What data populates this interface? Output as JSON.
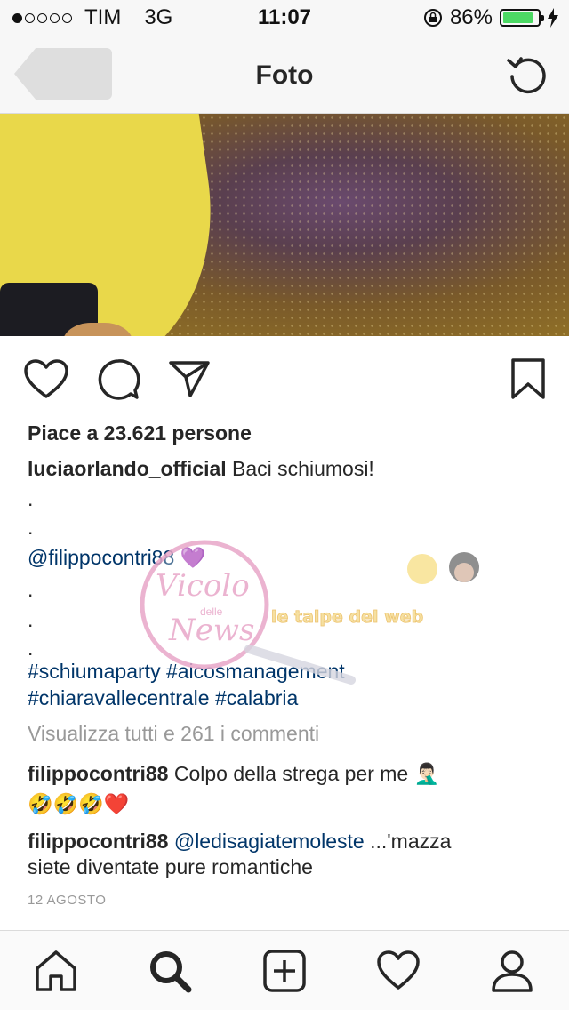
{
  "status_bar": {
    "carrier": "TIM",
    "network": "3G",
    "time": "11:07",
    "battery": "86%",
    "battery_level": 0.86
  },
  "nav": {
    "title": "Foto"
  },
  "post": {
    "likes": "Piace a 23.621 persone",
    "author": "luciaorlando_official",
    "caption": "Baci schiumosi!",
    "dot": ".",
    "mention": "@filippocontri88",
    "mention_emoji": "💜",
    "hashtags_line1": "#schiumaparty #aicosmanagement",
    "hashtags_line2": "#chiaravallecentrale #calabria",
    "view_comments": "Visualizza tutti e 261 i commenti",
    "comments": [
      {
        "user": "filippocontri88",
        "text": "Colpo della strega per me 🤦🏻‍♂️",
        "text2": "🤣🤣🤣❤️"
      },
      {
        "user": "filippocontri88",
        "mention": "@ledisagiatemoleste",
        "text": " ...'mazza",
        "text2": "siete diventate pure romantiche"
      }
    ],
    "date": "12 AGOSTO"
  },
  "watermark": {
    "brand1_line1": "Vicolo",
    "brand1_small": "delle",
    "brand1_line2": "News",
    "brand2": "le talpe del web"
  },
  "colors": {
    "link": "#003569",
    "battery": "#4cd964"
  }
}
